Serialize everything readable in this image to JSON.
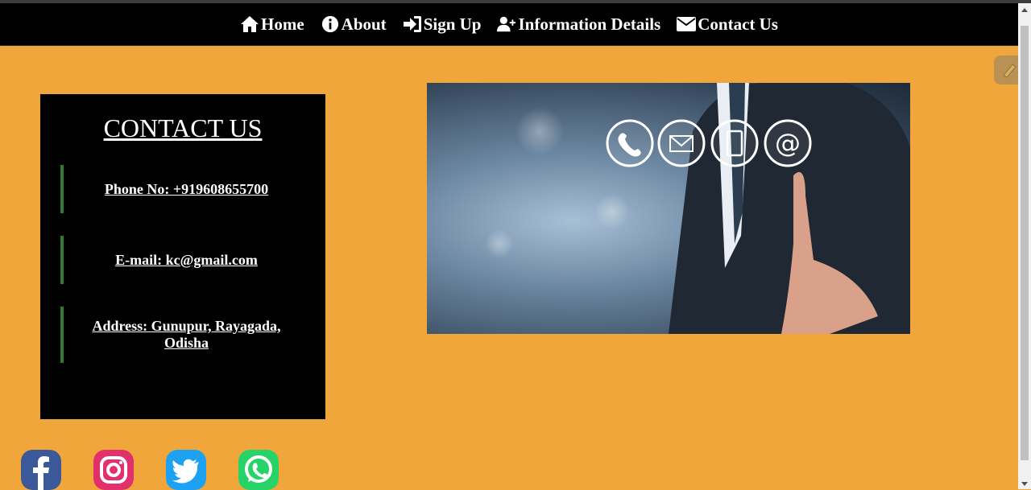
{
  "nav": {
    "items": [
      {
        "label": "Home",
        "icon": "home-icon"
      },
      {
        "label": "About",
        "icon": "info-icon"
      },
      {
        "label": "Sign Up",
        "icon": "sign-in-icon"
      },
      {
        "label": "Information Details",
        "icon": "user-plus-icon"
      },
      {
        "label": "Contact Us",
        "icon": "envelope-icon"
      }
    ]
  },
  "contact": {
    "title": "CONTACT US",
    "phone": "Phone No: +919608655700",
    "email": "E-mail: kc@gmail.com",
    "address": "Address: Gunupur, Rayagada, Odisha"
  },
  "hero": {
    "icon": "contact-hero-image"
  },
  "social": [
    {
      "name": "facebook-icon",
      "color": "#3b5998"
    },
    {
      "name": "instagram-icon",
      "color": "#e1306c"
    },
    {
      "name": "twitter-icon",
      "color": "#1da1f2"
    },
    {
      "name": "whatsapp-icon",
      "color": "#25d366"
    }
  ],
  "colors": {
    "background": "#f0a63a",
    "navbar": "#000000",
    "accent_border": "#2e7d32"
  }
}
